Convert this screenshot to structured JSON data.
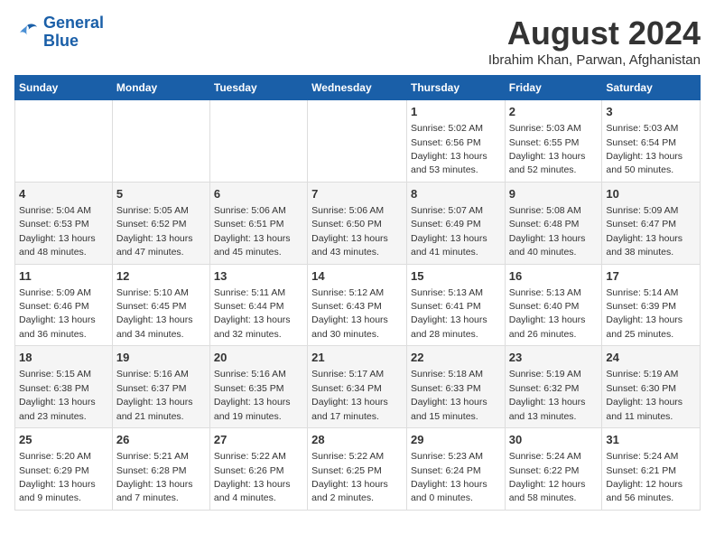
{
  "header": {
    "logo_line1": "General",
    "logo_line2": "Blue",
    "title": "August 2024",
    "subtitle": "Ibrahim Khan, Parwan, Afghanistan"
  },
  "weekdays": [
    "Sunday",
    "Monday",
    "Tuesday",
    "Wednesday",
    "Thursday",
    "Friday",
    "Saturday"
  ],
  "weeks": [
    [
      {
        "day": "",
        "info": ""
      },
      {
        "day": "",
        "info": ""
      },
      {
        "day": "",
        "info": ""
      },
      {
        "day": "",
        "info": ""
      },
      {
        "day": "1",
        "info": "Sunrise: 5:02 AM\nSunset: 6:56 PM\nDaylight: 13 hours\nand 53 minutes."
      },
      {
        "day": "2",
        "info": "Sunrise: 5:03 AM\nSunset: 6:55 PM\nDaylight: 13 hours\nand 52 minutes."
      },
      {
        "day": "3",
        "info": "Sunrise: 5:03 AM\nSunset: 6:54 PM\nDaylight: 13 hours\nand 50 minutes."
      }
    ],
    [
      {
        "day": "4",
        "info": "Sunrise: 5:04 AM\nSunset: 6:53 PM\nDaylight: 13 hours\nand 48 minutes."
      },
      {
        "day": "5",
        "info": "Sunrise: 5:05 AM\nSunset: 6:52 PM\nDaylight: 13 hours\nand 47 minutes."
      },
      {
        "day": "6",
        "info": "Sunrise: 5:06 AM\nSunset: 6:51 PM\nDaylight: 13 hours\nand 45 minutes."
      },
      {
        "day": "7",
        "info": "Sunrise: 5:06 AM\nSunset: 6:50 PM\nDaylight: 13 hours\nand 43 minutes."
      },
      {
        "day": "8",
        "info": "Sunrise: 5:07 AM\nSunset: 6:49 PM\nDaylight: 13 hours\nand 41 minutes."
      },
      {
        "day": "9",
        "info": "Sunrise: 5:08 AM\nSunset: 6:48 PM\nDaylight: 13 hours\nand 40 minutes."
      },
      {
        "day": "10",
        "info": "Sunrise: 5:09 AM\nSunset: 6:47 PM\nDaylight: 13 hours\nand 38 minutes."
      }
    ],
    [
      {
        "day": "11",
        "info": "Sunrise: 5:09 AM\nSunset: 6:46 PM\nDaylight: 13 hours\nand 36 minutes."
      },
      {
        "day": "12",
        "info": "Sunrise: 5:10 AM\nSunset: 6:45 PM\nDaylight: 13 hours\nand 34 minutes."
      },
      {
        "day": "13",
        "info": "Sunrise: 5:11 AM\nSunset: 6:44 PM\nDaylight: 13 hours\nand 32 minutes."
      },
      {
        "day": "14",
        "info": "Sunrise: 5:12 AM\nSunset: 6:43 PM\nDaylight: 13 hours\nand 30 minutes."
      },
      {
        "day": "15",
        "info": "Sunrise: 5:13 AM\nSunset: 6:41 PM\nDaylight: 13 hours\nand 28 minutes."
      },
      {
        "day": "16",
        "info": "Sunrise: 5:13 AM\nSunset: 6:40 PM\nDaylight: 13 hours\nand 26 minutes."
      },
      {
        "day": "17",
        "info": "Sunrise: 5:14 AM\nSunset: 6:39 PM\nDaylight: 13 hours\nand 25 minutes."
      }
    ],
    [
      {
        "day": "18",
        "info": "Sunrise: 5:15 AM\nSunset: 6:38 PM\nDaylight: 13 hours\nand 23 minutes."
      },
      {
        "day": "19",
        "info": "Sunrise: 5:16 AM\nSunset: 6:37 PM\nDaylight: 13 hours\nand 21 minutes."
      },
      {
        "day": "20",
        "info": "Sunrise: 5:16 AM\nSunset: 6:35 PM\nDaylight: 13 hours\nand 19 minutes."
      },
      {
        "day": "21",
        "info": "Sunrise: 5:17 AM\nSunset: 6:34 PM\nDaylight: 13 hours\nand 17 minutes."
      },
      {
        "day": "22",
        "info": "Sunrise: 5:18 AM\nSunset: 6:33 PM\nDaylight: 13 hours\nand 15 minutes."
      },
      {
        "day": "23",
        "info": "Sunrise: 5:19 AM\nSunset: 6:32 PM\nDaylight: 13 hours\nand 13 minutes."
      },
      {
        "day": "24",
        "info": "Sunrise: 5:19 AM\nSunset: 6:30 PM\nDaylight: 13 hours\nand 11 minutes."
      }
    ],
    [
      {
        "day": "25",
        "info": "Sunrise: 5:20 AM\nSunset: 6:29 PM\nDaylight: 13 hours\nand 9 minutes."
      },
      {
        "day": "26",
        "info": "Sunrise: 5:21 AM\nSunset: 6:28 PM\nDaylight: 13 hours\nand 7 minutes."
      },
      {
        "day": "27",
        "info": "Sunrise: 5:22 AM\nSunset: 6:26 PM\nDaylight: 13 hours\nand 4 minutes."
      },
      {
        "day": "28",
        "info": "Sunrise: 5:22 AM\nSunset: 6:25 PM\nDaylight: 13 hours\nand 2 minutes."
      },
      {
        "day": "29",
        "info": "Sunrise: 5:23 AM\nSunset: 6:24 PM\nDaylight: 13 hours\nand 0 minutes."
      },
      {
        "day": "30",
        "info": "Sunrise: 5:24 AM\nSunset: 6:22 PM\nDaylight: 12 hours\nand 58 minutes."
      },
      {
        "day": "31",
        "info": "Sunrise: 5:24 AM\nSunset: 6:21 PM\nDaylight: 12 hours\nand 56 minutes."
      }
    ]
  ]
}
